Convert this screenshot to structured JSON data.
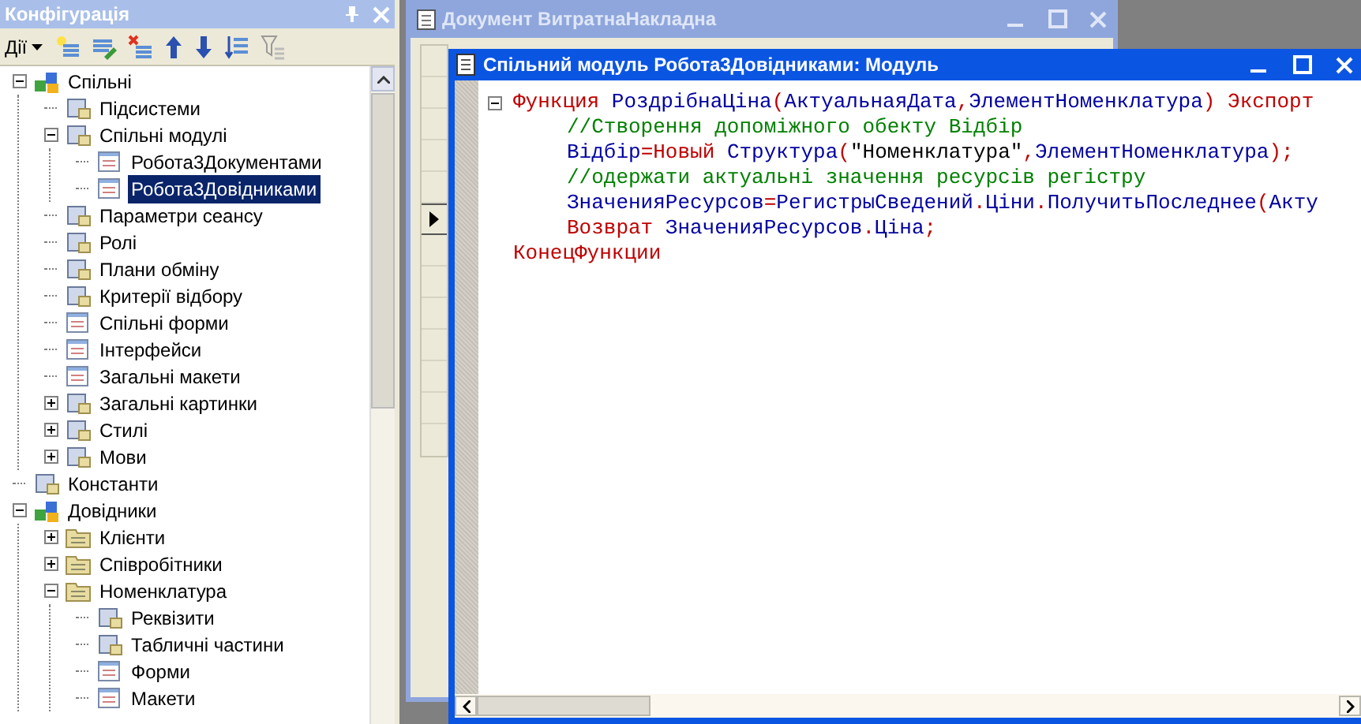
{
  "config_panel": {
    "title": "Конфігурація",
    "actions_menu": "Дії",
    "tree": [
      {
        "label": "Спільні",
        "kind": "category",
        "expanded": true,
        "selected": false,
        "children": [
          {
            "label": "Підсистеми",
            "kind": "item",
            "selected": false
          },
          {
            "label": "Спільні модулі",
            "kind": "item",
            "expanded": true,
            "selected": false,
            "children": [
              {
                "label": "Робота3Документами",
                "kind": "module",
                "selected": false
              },
              {
                "label": "Робота3Довідниками",
                "kind": "module",
                "selected": true
              }
            ]
          },
          {
            "label": "Параметри сеансу",
            "kind": "item",
            "selected": false
          },
          {
            "label": "Ролі",
            "kind": "item",
            "selected": false
          },
          {
            "label": "Плани обміну",
            "kind": "item",
            "selected": false
          },
          {
            "label": "Критерії відбору",
            "kind": "item",
            "selected": false
          },
          {
            "label": "Спільні форми",
            "kind": "module",
            "selected": false
          },
          {
            "label": "Інтерфейси",
            "kind": "module",
            "selected": false
          },
          {
            "label": "Загальні макети",
            "kind": "module",
            "selected": false
          },
          {
            "label": "Загальні картинки",
            "kind": "item",
            "expanded": false,
            "selected": false
          },
          {
            "label": "Стилі",
            "kind": "item",
            "expanded": false,
            "selected": false
          },
          {
            "label": "Мови",
            "kind": "item",
            "expanded": false,
            "selected": false
          }
        ]
      },
      {
        "label": "Константи",
        "kind": "item",
        "selected": false
      },
      {
        "label": "Довідники",
        "kind": "category",
        "expanded": true,
        "selected": false,
        "children": [
          {
            "label": "Клієнти",
            "kind": "folder",
            "expanded": false,
            "selected": false
          },
          {
            "label": "Співробітники",
            "kind": "folder",
            "expanded": false,
            "selected": false
          },
          {
            "label": "Номенклатура",
            "kind": "folder",
            "expanded": true,
            "selected": false,
            "children": [
              {
                "label": "Реквізити",
                "kind": "item",
                "selected": false
              },
              {
                "label": "Табличні частини",
                "kind": "item",
                "selected": false
              },
              {
                "label": "Форми",
                "kind": "module",
                "selected": false
              },
              {
                "label": "Макети",
                "kind": "module",
                "selected": false
              }
            ]
          }
        ]
      }
    ]
  },
  "back_window": {
    "title": "Документ ВитратнаНакладна"
  },
  "module_window": {
    "title": "Спільний модуль Робота3Довідниками: Модуль",
    "code": [
      {
        "expanded": true,
        "tokens": [
          {
            "kind": "kw",
            "text": "Функция"
          },
          {
            "kind": "id",
            "text": " РоздрібнаЦіна"
          },
          {
            "kind": "op",
            "text": "("
          },
          {
            "kind": "id",
            "text": "АктуальнаяДата"
          },
          {
            "kind": "op",
            "text": ","
          },
          {
            "kind": "id",
            "text": "ЭлементНоменклатура"
          },
          {
            "kind": "op",
            "text": ")"
          },
          {
            "kind": "kw",
            "text": " Экспорт"
          }
        ],
        "children": [
          {
            "tokens": [
              {
                "kind": "comment",
                "text": "//Створення допоміжного обекту Відбір"
              }
            ]
          },
          {
            "tokens": [
              {
                "kind": "id",
                "text": "Відбір"
              },
              {
                "kind": "op",
                "text": "="
              },
              {
                "kind": "kw",
                "text": "Новый"
              },
              {
                "kind": "id",
                "text": " Структура"
              },
              {
                "kind": "op",
                "text": "("
              },
              {
                "kind": "str",
                "text": "\"Номенклатура\""
              },
              {
                "kind": "op",
                "text": ","
              },
              {
                "kind": "id",
                "text": "ЭлементНоменклатура"
              },
              {
                "kind": "op",
                "text": ");"
              }
            ]
          },
          {
            "tokens": [
              {
                "kind": "comment",
                "text": "//одержати актуальні значення ресурсів регістру"
              }
            ]
          },
          {
            "tokens": [
              {
                "kind": "id",
                "text": "ЗначенияРесурсов"
              },
              {
                "kind": "op",
                "text": "="
              },
              {
                "kind": "id",
                "text": "РегистрыСведений"
              },
              {
                "kind": "op",
                "text": "."
              },
              {
                "kind": "id",
                "text": "Ціни"
              },
              {
                "kind": "op",
                "text": "."
              },
              {
                "kind": "id",
                "text": "ПолучитьПоследнее"
              },
              {
                "kind": "op",
                "text": "("
              },
              {
                "kind": "id",
                "text": "Акту"
              }
            ]
          },
          {
            "tokens": [
              {
                "kind": "kw",
                "text": "Возврат"
              },
              {
                "kind": "id",
                "text": " ЗначенияРесурсов"
              },
              {
                "kind": "op",
                "text": "."
              },
              {
                "kind": "id",
                "text": "Ціна"
              },
              {
                "kind": "op",
                "text": ";"
              }
            ]
          }
        ]
      },
      {
        "tokens": [
          {
            "kind": "kw",
            "text": "КонецФункции"
          }
        ]
      }
    ]
  }
}
